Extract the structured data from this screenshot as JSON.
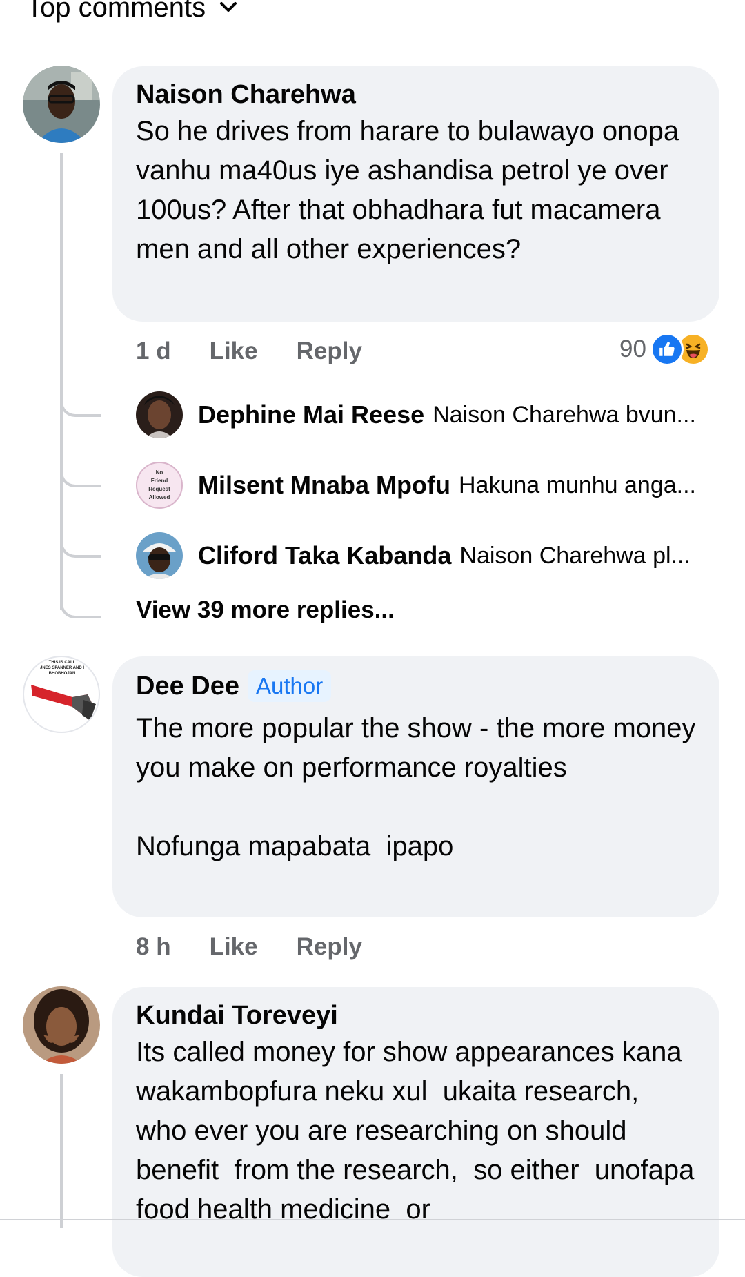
{
  "header": {
    "sort_label": "Top comments"
  },
  "comments": [
    {
      "author": "Naison Charehwa",
      "text": "So he drives from harare to bulawayo onopa vanhu ma40us iye ashandisa petrol ye over 100us? After that obhadhara fut macamera men and all other experiences?",
      "age": "1 d",
      "like_label": "Like",
      "reply_label": "Reply",
      "reaction_count": "90",
      "reactions": [
        "like-icon",
        "haha-icon"
      ],
      "replies": [
        {
          "author": "Dephine Mai Reese",
          "snippet": "Naison Charehwa bvun..."
        },
        {
          "author": "Milsent Mnaba Mpofu",
          "snippet": "Hakuna munhu anga...",
          "avatar_text": [
            "No",
            "Friend",
            "Request",
            "Allowed"
          ]
        },
        {
          "author": "Cliford Taka Kabanda",
          "snippet": "Naison Charehwa pl..."
        }
      ],
      "view_more": "View 39 more replies..."
    },
    {
      "author": "Dee Dee",
      "badge": "Author",
      "text": "The more popular the show - the more money you make on performance royalties\n\nNofunga mapabata  ipapo",
      "age": "8 h",
      "like_label": "Like",
      "reply_label": "Reply",
      "avatar_text": [
        "THIS IS CALL",
        "JNES SPANNER AND I",
        "BHOBHOJAN"
      ]
    },
    {
      "author": "Kundai Toreveyi",
      "text": "Its called money for show appearances kana wakambopfura neku xul  ukaita research,  who ever you are researching on should  benefit  from the research,  so either  unofapa food health medicine  or"
    }
  ],
  "colors": {
    "accent": "#1877f2",
    "bubble": "#f0f2f5",
    "meta": "#65676b",
    "haha": "#f7b125"
  }
}
